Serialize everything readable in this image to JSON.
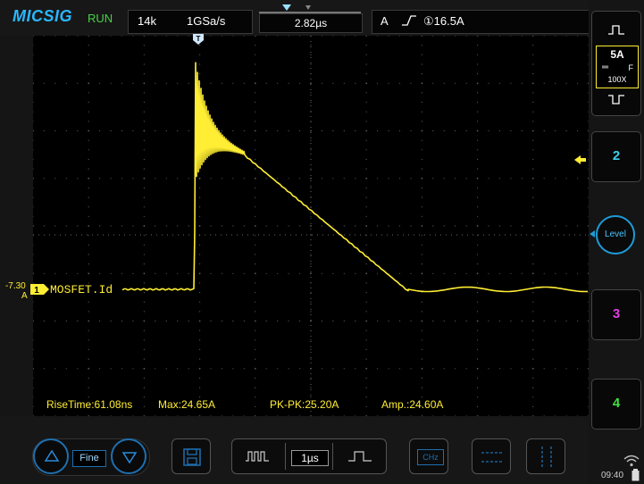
{
  "header": {
    "brand": "MICSIG",
    "run_state": "RUN",
    "memory_depth": "14k",
    "sample_rate": "1GSa/s",
    "time_offset": "2.82µs",
    "trigger_mode": "A",
    "trigger_source_level": "①16.5A"
  },
  "channel1": {
    "scale": "5A",
    "coupling": "F",
    "probe": "100X",
    "name": "MOSFET.Id",
    "offset_value": "-7.30",
    "offset_unit": "A",
    "marker": "1",
    "color": "#ffee33"
  },
  "right_panel": {
    "ch2_label": "2",
    "ch3_label": "3",
    "ch4_label": "4",
    "level_label": "Level",
    "ch2_color": "#3fd0e8",
    "ch3_color": "#e040e0",
    "ch4_color": "#40e040"
  },
  "measurements": {
    "rise_time": "RiseTime:61.08ns",
    "max": "Max:24.65A",
    "pk_pk": "PK-PK:25.20A",
    "amp": "Amp.:24.60A"
  },
  "bottom": {
    "fine_label": "Fine",
    "timebase": "1µs"
  },
  "status": {
    "time": "09:40"
  }
}
